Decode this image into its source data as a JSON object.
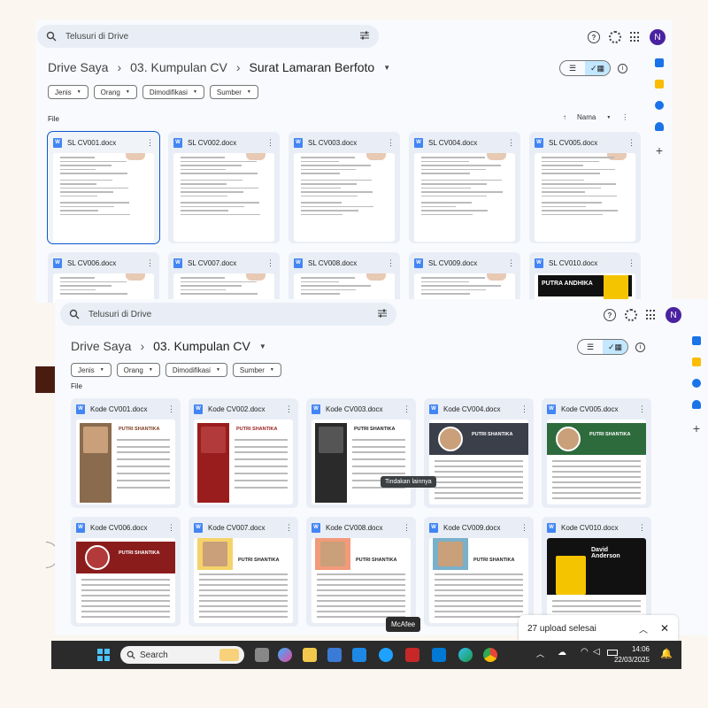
{
  "window1": {
    "search_placeholder": "Telusuri di Drive",
    "avatar_letter": "N",
    "breadcrumbs": [
      "Drive Saya",
      "03. Kumpulan CV",
      "Surat Lamaran Berfoto"
    ],
    "filters": [
      "Jenis",
      "Orang",
      "Dimodifikasi",
      "Sumber"
    ],
    "section_label": "File",
    "sort_label": "Nama",
    "files": [
      "SL CV001.docx",
      "SL CV002.docx",
      "SL CV003.docx",
      "SL CV004.docx",
      "SL CV005.docx",
      "SL CV006.docx",
      "SL CV007.docx",
      "SL CV008.docx",
      "SL CV009.docx",
      "SL CV010.docx"
    ],
    "cv010_title": "PUTRA ANDHIKA"
  },
  "window2": {
    "search_placeholder": "Telusuri di Drive",
    "avatar_letter": "N",
    "breadcrumbs": [
      "Drive Saya",
      "03. Kumpulan CV"
    ],
    "filters": [
      "Jenis",
      "Orang",
      "Dimodifikasi",
      "Sumber"
    ],
    "section_label": "File",
    "files": [
      "Kode CV001.docx",
      "Kode CV002.docx",
      "Kode CV003.docx",
      "Kode CV004.docx",
      "Kode CV005.docx",
      "Kode CV006.docx",
      "Kode CV007.docx",
      "Kode CV008.docx",
      "Kode CV009.docx",
      "Kode CV010.docx"
    ],
    "cv_name": "PUTRI SHANTIKA",
    "cv010_name": "David Anderson",
    "tooltip": "Tindakan lainnya"
  },
  "upload": {
    "status": "27 upload selesai"
  },
  "taskbar": {
    "search_label": "Search",
    "time": "14:06",
    "date": "22/03/2025",
    "tooltip": "McAfee"
  },
  "colors": {
    "accent": "#0b57d0",
    "selected_view": "#c2e7ff",
    "doc_icon": "#4285f4",
    "avatar": "#4a22a0"
  }
}
